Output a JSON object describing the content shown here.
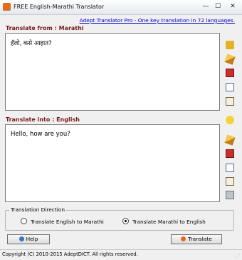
{
  "window": {
    "title": "FREE English-Marathi Translator",
    "min_glyph": "—",
    "max_glyph": "☐",
    "close_glyph": "✕"
  },
  "promo": {
    "link_text": "Adept Translator Pro - One key translation in 72 languages."
  },
  "source": {
    "label": "Translate from : Marathi",
    "text": "हॅलो, कसे आहात?"
  },
  "target": {
    "label": "Translate into : English",
    "text": "Hello, how are you?"
  },
  "side_icons_top": [
    "open-folder-icon",
    "clear-pen-icon",
    "save-icon",
    "copy-icon",
    "paste-icon"
  ],
  "side_icons_bottom": [
    "smiley-icon",
    "clear-pen-icon",
    "save-icon",
    "copy-icon",
    "paste-icon",
    "print-icon"
  ],
  "direction": {
    "legend": "Translation Direction",
    "option_en_to_mr": "Translate English to Marathi",
    "option_mr_to_en": "Translate Marathi to English",
    "selected": "Translate Marathi to English"
  },
  "buttons": {
    "help": "Help",
    "translate": "Translate"
  },
  "status": {
    "copyright": "Copyright (C) 2010-2015 AdeptDICT. All rights reserved."
  },
  "colors": {
    "label_color": "#7a1a1a",
    "link_color": "#0000cc"
  }
}
